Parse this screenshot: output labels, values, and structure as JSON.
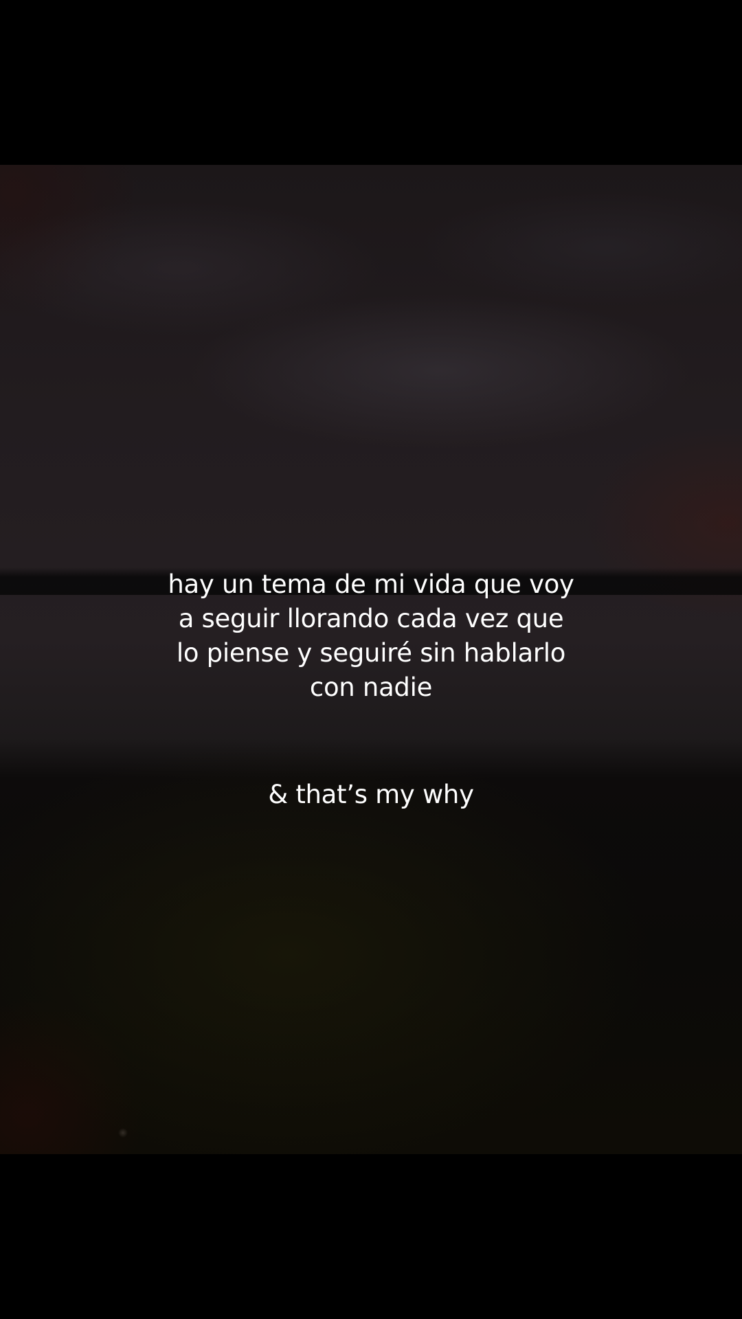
{
  "caption": {
    "lines": [
      "hay un tema de mi vida que voy",
      "a seguir llorando cada vez que",
      "lo piense y seguiré sin hablarlo",
      "con nadie"
    ],
    "tagline": "& that’s my why"
  }
}
